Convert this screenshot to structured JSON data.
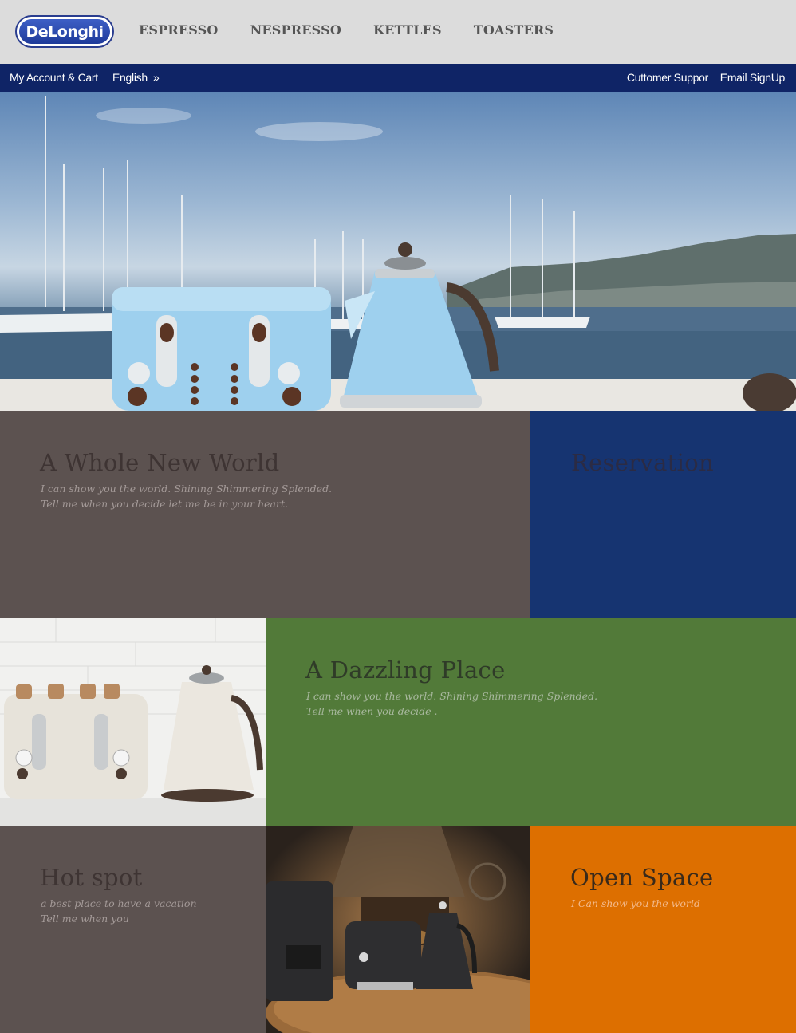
{
  "brand": {
    "logo_text": "DeLonghi"
  },
  "nav": {
    "items": [
      "ESPRESSO",
      "NESPRESSO",
      "KETTLES",
      "TOASTERS"
    ]
  },
  "subbar": {
    "account": "My Account & Cart",
    "language": "English",
    "language_icon": "double-chevron-right-icon",
    "support": "Cuttomer Suppor",
    "email": "Email SignUp"
  },
  "hero": {
    "image": "harbor-toaster-kettle-photo"
  },
  "tiles": {
    "whole_new_world": {
      "title": "A Whole New World",
      "line1": "I can show you the world. Shining Shimmering Splended.",
      "line2": "Tell me when you decide let me be in your heart."
    },
    "reservation": {
      "title": "Reservation"
    },
    "dazzling": {
      "title": "A Dazzling Place",
      "line1": "I can show you the world. Shining Shimmering Splended.",
      "line2": "Tell me when you decide ."
    },
    "hot_spot": {
      "title": "Hot spot",
      "line1": "a best place to have a vacation",
      "line2": "Tell me when you"
    },
    "open_space": {
      "title": "Open Space",
      "line1": "I Can show you the world"
    }
  },
  "colors": {
    "header_bg": "#dcdcdc",
    "subbar_bg": "#0f2466",
    "tile_brown": "#5c5250",
    "tile_blue": "#163471",
    "tile_green": "#527a39",
    "tile_orange": "#dd6f00"
  }
}
